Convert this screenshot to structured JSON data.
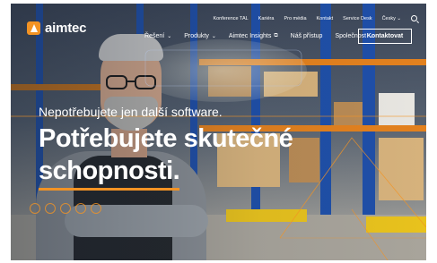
{
  "brand": {
    "name": "aimtec",
    "accent": "#f39324"
  },
  "topnav": {
    "items": [
      "Konference TAL",
      "Kariéra",
      "Pro média",
      "Kontakt",
      "Service Desk",
      "Česky"
    ],
    "language_chevron": "⌄"
  },
  "mainnav": {
    "items": [
      {
        "label": "Řešení",
        "chevron": "⌄"
      },
      {
        "label": "Produkty",
        "chevron": "⌄"
      },
      {
        "label": "Aimtec Insights",
        "chevron": "⧉"
      },
      {
        "label": "Náš přístup",
        "chevron": ""
      },
      {
        "label": "Společnost",
        "chevron": "⌄"
      }
    ],
    "cta_label": "Kontaktovat"
  },
  "hero": {
    "subline": "Nepotřebujete jen další software.",
    "headline_line1": "Potřebujete skutečné",
    "headline_line2": "schopnosti."
  },
  "icons": [
    "logo-mark-icon",
    "search-icon",
    "chevron-down-icon",
    "external-link-icon"
  ]
}
